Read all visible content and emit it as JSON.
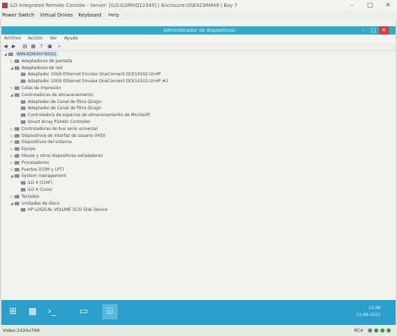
{
  "ilo": {
    "title": "iLO Integrated Remote Console - Server: [iLO:ILOMXQ12345] | Enclosure:USE423RM49 | Bay 7",
    "menu": [
      "Power Switch",
      "Virtual Drives",
      "Keyboard",
      "Help"
    ],
    "status_video": "Video:1024x768",
    "status_rc": "RC4"
  },
  "devmgr": {
    "title": "Administrador de dispositivos",
    "menu": [
      "Archivo",
      "Acción",
      "Ver",
      "Ayuda"
    ],
    "tree": [
      {
        "label": "WIN-KDIK6H78OO1",
        "level": 0,
        "exp": "◢"
      },
      {
        "label": "Adaptadores de pantalla",
        "level": 1,
        "exp": "▷"
      },
      {
        "label": "Adaptadores de red",
        "level": 1,
        "exp": "◢"
      },
      {
        "label": "Adaptador 10Gb Ethernet Emulex OneConnect OCE14102-UI-HP",
        "level": 2,
        "exp": ""
      },
      {
        "label": "Adaptador 10Gb Ethernet Emulex OneConnect OCE14102-UI-HP #2",
        "level": 2,
        "exp": ""
      },
      {
        "label": "Colas de impresión",
        "level": 1,
        "exp": "▷"
      },
      {
        "label": "Controladoras de almacenamiento",
        "level": 1,
        "exp": "◢"
      },
      {
        "label": "Adaptador de Canal de fibra QLogic",
        "level": 2,
        "exp": ""
      },
      {
        "label": "Adaptador de Canal de fibra QLogic",
        "level": 2,
        "exp": ""
      },
      {
        "label": "Controladora de espacios de almacenamiento de Microsoft",
        "level": 2,
        "exp": ""
      },
      {
        "label": "Smart Array P244br Controller",
        "level": 2,
        "exp": ""
      },
      {
        "label": "Controladoras de bus serie universal",
        "level": 1,
        "exp": "▷"
      },
      {
        "label": "Dispositivos de interfaz de usuario (HID)",
        "level": 1,
        "exp": "▷"
      },
      {
        "label": "Dispositivos del sistema",
        "level": 1,
        "exp": "▷"
      },
      {
        "label": "Equipo",
        "level": 1,
        "exp": "▷"
      },
      {
        "label": "Mouse y otros dispositivos señaladores",
        "level": 1,
        "exp": "▷"
      },
      {
        "label": "Procesadores",
        "level": 1,
        "exp": "▷"
      },
      {
        "label": "Puertos (COM y LPT)",
        "level": 1,
        "exp": "▷"
      },
      {
        "label": "System management",
        "level": 1,
        "exp": "◢"
      },
      {
        "label": "iLO 4 (CHIF)",
        "level": 2,
        "exp": ""
      },
      {
        "label": "iLO 4 (Core)",
        "level": 2,
        "exp": ""
      },
      {
        "label": "Teclados",
        "level": 1,
        "exp": "▷"
      },
      {
        "label": "Unidades de disco",
        "level": 1,
        "exp": "◢"
      },
      {
        "label": "HP LOGICAL VOLUME SCSI Disk Device",
        "level": 2,
        "exp": ""
      }
    ]
  },
  "taskbar": {
    "time": "23:28",
    "date": "11-06-2021"
  },
  "colors": {
    "titlebar": "#35a9c8",
    "taskbar": "#2b9fcc",
    "close": "#d43f3f"
  }
}
